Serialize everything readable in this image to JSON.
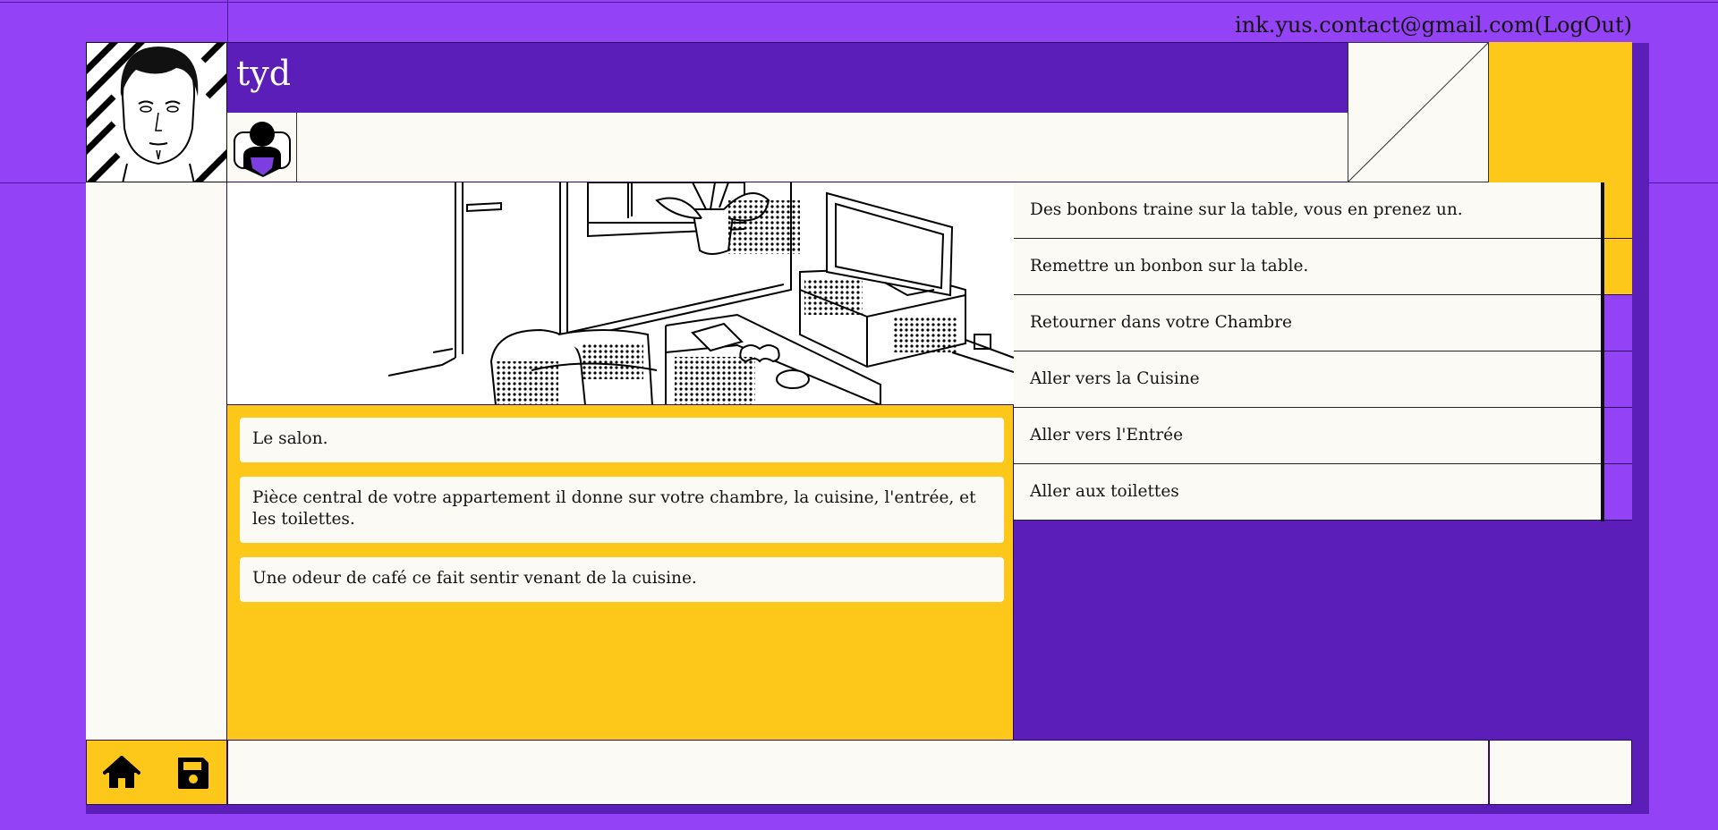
{
  "header": {
    "account_label": "ink.yus.contact@gmail.com(LogOut)"
  },
  "player": {
    "name": "tyd",
    "portrait_icon": "man-portrait",
    "avatar_icon": "person-avatar-icon"
  },
  "scene": {
    "image_icon": "living-room-illustration"
  },
  "story": {
    "paragraphs": [
      "Le salon.",
      "Pièce central de votre appartement il donne sur votre chambre, la cuisine, l'entrée, et les toilettes.",
      "Une odeur de café ce fait sentir venant de la cuisine."
    ]
  },
  "choices": [
    "Des bonbons traine sur la table, vous en prenez un.",
    "Remettre un bonbon sur la table.",
    "Retourner dans votre Chambre",
    "Aller vers la Cuisine",
    "Aller vers l'Entrée",
    "Aller aux toilettes"
  ],
  "toolbar": {
    "home_icon": "home-icon",
    "save_icon": "save-icon"
  },
  "colors": {
    "background": "#9442f5",
    "dark_purple": "#5b1eb8",
    "yellow": "#fec81a",
    "paper": "#fbfaf5"
  }
}
